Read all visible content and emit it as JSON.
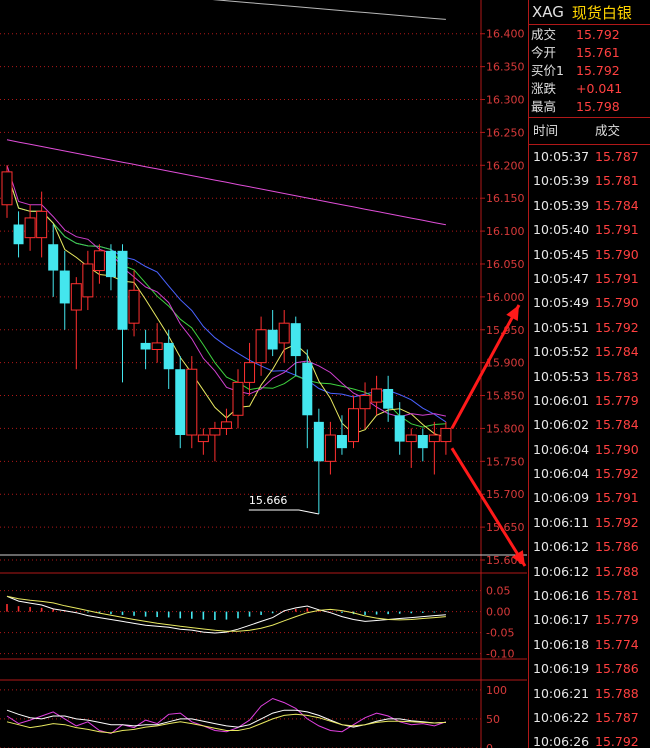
{
  "quote": {
    "code": "XAG",
    "name": "现货白银",
    "fields": [
      {
        "label": "成交",
        "value": "15.792"
      },
      {
        "label": "今开",
        "value": "15.761"
      },
      {
        "label": "买价1",
        "value": "15.792"
      },
      {
        "label": "涨跌",
        "value": "+0.041"
      },
      {
        "label": "最高",
        "value": "15.798"
      }
    ],
    "tick_header": {
      "time": "时间",
      "price": "成交"
    },
    "ticks": [
      {
        "time": "10:05:37",
        "price": "15.787"
      },
      {
        "time": "10:05:39",
        "price": "15.781"
      },
      {
        "time": "10:05:39",
        "price": "15.784"
      },
      {
        "time": "10:05:40",
        "price": "15.791"
      },
      {
        "time": "10:05:45",
        "price": "15.790"
      },
      {
        "time": "10:05:47",
        "price": "15.791"
      },
      {
        "time": "10:05:49",
        "price": "15.790"
      },
      {
        "time": "10:05:51",
        "price": "15.792"
      },
      {
        "time": "10:05:52",
        "price": "15.784"
      },
      {
        "time": "10:05:53",
        "price": "15.783"
      },
      {
        "time": "10:06:01",
        "price": "15.779"
      },
      {
        "time": "10:06:02",
        "price": "15.784"
      },
      {
        "time": "10:06:04",
        "price": "15.790"
      },
      {
        "time": "10:06:04",
        "price": "15.792"
      },
      {
        "time": "10:06:09",
        "price": "15.791"
      },
      {
        "time": "10:06:11",
        "price": "15.792"
      },
      {
        "time": "10:06:12",
        "price": "15.786"
      },
      {
        "time": "10:06:12",
        "price": "15.788"
      },
      {
        "time": "10:06:16",
        "price": "15.781"
      },
      {
        "time": "10:06:17",
        "price": "15.779"
      },
      {
        "time": "10:06:18",
        "price": "15.774"
      },
      {
        "time": "10:06:19",
        "price": "15.786"
      },
      {
        "time": "10:06:21",
        "price": "15.788"
      },
      {
        "time": "10:06:22",
        "price": "15.787"
      },
      {
        "time": "10:06:26",
        "price": "15.792"
      }
    ]
  },
  "colors": {
    "up": "#ff3030",
    "down": "#44e6ee",
    "grid": "#b01818",
    "axis_text": "#d83a3a"
  },
  "annotation": {
    "label": "15.666"
  },
  "chart_data": [
    {
      "type": "candlestick",
      "ylim": [
        15.6,
        16.43
      ],
      "y_ticks": [
        "16.400",
        "16.350",
        "16.300",
        "16.250",
        "16.200",
        "16.150",
        "16.100",
        "16.050",
        "16.000",
        "15.950",
        "15.900",
        "15.850",
        "15.800",
        "15.750",
        "15.700",
        "15.650",
        "15.600"
      ],
      "grid": true,
      "candles": [
        {
          "o": 16.14,
          "c": 16.19,
          "h": 16.2,
          "l": 16.12
        },
        {
          "o": 16.11,
          "c": 16.08,
          "h": 16.13,
          "l": 16.06
        },
        {
          "o": 16.09,
          "c": 16.12,
          "h": 16.14,
          "l": 16.07
        },
        {
          "o": 16.09,
          "c": 16.13,
          "h": 16.16,
          "l": 16.06
        },
        {
          "o": 16.08,
          "c": 16.04,
          "h": 16.11,
          "l": 16.0
        },
        {
          "o": 16.04,
          "c": 15.99,
          "h": 16.07,
          "l": 15.95
        },
        {
          "o": 15.98,
          "c": 16.02,
          "h": 16.03,
          "l": 15.89
        },
        {
          "o": 16.0,
          "c": 16.05,
          "h": 16.07,
          "l": 15.98
        },
        {
          "o": 16.04,
          "c": 16.07,
          "h": 16.08,
          "l": 16.02
        },
        {
          "o": 16.07,
          "c": 16.03,
          "h": 16.08,
          "l": 16.01
        },
        {
          "o": 16.07,
          "c": 15.95,
          "h": 16.08,
          "l": 15.87
        },
        {
          "o": 15.96,
          "c": 16.01,
          "h": 16.04,
          "l": 15.94
        },
        {
          "o": 15.93,
          "c": 15.92,
          "h": 15.95,
          "l": 15.89
        },
        {
          "o": 15.92,
          "c": 15.93,
          "h": 15.96,
          "l": 15.9
        },
        {
          "o": 15.93,
          "c": 15.89,
          "h": 15.95,
          "l": 15.86
        },
        {
          "o": 15.89,
          "c": 15.79,
          "h": 15.91,
          "l": 15.77
        },
        {
          "o": 15.79,
          "c": 15.89,
          "h": 15.91,
          "l": 15.77
        },
        {
          "o": 15.78,
          "c": 15.79,
          "h": 15.8,
          "l": 15.76
        },
        {
          "o": 15.79,
          "c": 15.8,
          "h": 15.81,
          "l": 15.75
        },
        {
          "o": 15.8,
          "c": 15.81,
          "h": 15.83,
          "l": 15.79
        },
        {
          "o": 15.82,
          "c": 15.87,
          "h": 15.89,
          "l": 15.8
        },
        {
          "o": 15.87,
          "c": 15.9,
          "h": 15.93,
          "l": 15.85
        },
        {
          "o": 15.9,
          "c": 15.95,
          "h": 15.97,
          "l": 15.88
        },
        {
          "o": 15.95,
          "c": 15.92,
          "h": 15.98,
          "l": 15.91
        },
        {
          "o": 15.93,
          "c": 15.96,
          "h": 15.98,
          "l": 15.9
        },
        {
          "o": 15.96,
          "c": 15.91,
          "h": 15.97,
          "l": 15.88
        },
        {
          "o": 15.9,
          "c": 15.82,
          "h": 15.92,
          "l": 15.77
        },
        {
          "o": 15.81,
          "c": 15.75,
          "h": 15.83,
          "l": 15.67
        },
        {
          "o": 15.75,
          "c": 15.79,
          "h": 15.81,
          "l": 15.73
        },
        {
          "o": 15.79,
          "c": 15.77,
          "h": 15.82,
          "l": 15.76
        },
        {
          "o": 15.78,
          "c": 15.83,
          "h": 15.85,
          "l": 15.77
        },
        {
          "o": 15.83,
          "c": 15.85,
          "h": 15.87,
          "l": 15.8
        },
        {
          "o": 15.84,
          "c": 15.86,
          "h": 15.88,
          "l": 15.82
        },
        {
          "o": 15.86,
          "c": 15.83,
          "h": 15.88,
          "l": 15.81
        },
        {
          "o": 15.82,
          "c": 15.78,
          "h": 15.84,
          "l": 15.76
        },
        {
          "o": 15.78,
          "c": 15.79,
          "h": 15.8,
          "l": 15.74
        },
        {
          "o": 15.79,
          "c": 15.77,
          "h": 15.8,
          "l": 15.75
        },
        {
          "o": 15.78,
          "c": 15.79,
          "h": 15.81,
          "l": 15.73
        },
        {
          "o": 15.78,
          "c": 15.8,
          "h": 15.81,
          "l": 15.76
        }
      ]
    },
    {
      "type": "bar",
      "ylim": [
        -0.12,
        0.08
      ],
      "y_ticks": [
        "0.05",
        "0.00",
        "-0.05",
        "-0.10"
      ],
      "values": [
        0.018,
        0.013,
        0.011,
        0.009,
        0.005,
        0.003,
        0.001,
        -0.002,
        -0.004,
        -0.006,
        -0.008,
        -0.01,
        -0.012,
        -0.013,
        -0.014,
        -0.016,
        -0.017,
        -0.019,
        -0.02,
        -0.019,
        -0.016,
        -0.012,
        -0.008,
        -0.004,
        0.003,
        0.006,
        0.008,
        0.004,
        0.001,
        -0.003,
        -0.006,
        -0.008,
        -0.007,
        -0.006,
        -0.005,
        -0.004,
        -0.003,
        -0.002,
        -0.001
      ]
    },
    {
      "type": "line",
      "ylim": [
        0,
        110
      ],
      "y_ticks": [
        "100",
        "50",
        "0"
      ],
      "series": [
        {
          "values": [
            55,
            42,
            48,
            55,
            62,
            50,
            38,
            45,
            30,
            25,
            40,
            35,
            48,
            42,
            58,
            60,
            45,
            38,
            30,
            28,
            35,
            48,
            72,
            85,
            78,
            68,
            50,
            38,
            30,
            28,
            40,
            52,
            60,
            55,
            45,
            40,
            42,
            38,
            45
          ]
        },
        {
          "values": [
            65,
            58,
            52,
            50,
            55,
            55,
            50,
            48,
            44,
            40,
            40,
            38,
            40,
            40,
            45,
            50,
            50,
            46,
            42,
            38,
            36,
            40,
            50,
            60,
            65,
            65,
            62,
            56,
            48,
            40,
            36,
            40,
            46,
            50,
            50,
            47,
            45,
            43,
            44
          ]
        },
        {
          "values": [
            45,
            40,
            35,
            38,
            42,
            40,
            35,
            32,
            28,
            26,
            30,
            32,
            36,
            38,
            42,
            45,
            42,
            38,
            34,
            30,
            30,
            34,
            42,
            50,
            56,
            58,
            56,
            52,
            46,
            40,
            38,
            40,
            44,
            46,
            46,
            45,
            44,
            43,
            44
          ]
        }
      ]
    }
  ]
}
